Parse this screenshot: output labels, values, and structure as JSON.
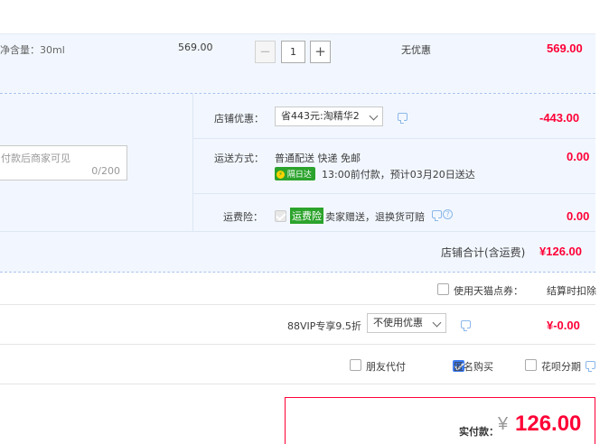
{
  "item": {
    "spec": "净含量：30ml",
    "price": "569.00",
    "qty": "1",
    "minus": "−",
    "plus": "+",
    "discount": "无优惠",
    "subtotal": "569.00"
  },
  "shop": {
    "coupon_label": "店铺优惠：",
    "coupon_select": "省443元:淘精华2",
    "coupon_amount": "-443.00",
    "message_placeholder": "付款后商家可见",
    "message_count": "0/200",
    "shipping_label": "运送方式：",
    "shipping_method": "普通配送 快递 免邮",
    "next_day_badge": "隔日达",
    "delivery_promise": "13:00前付款，预计03月20日送达",
    "shipping_amount": "0.00",
    "insurance_label": "运费险：",
    "insurance_badge": "运费险",
    "insurance_text": "卖家赠送，退换货可赔",
    "insurance_amount": "0.00",
    "total_label": "店铺合计(含运费)",
    "total_amount": "¥126.00"
  },
  "points": {
    "label": "使用天猫点券：",
    "note": "结算时扣除"
  },
  "vip": {
    "label": "88VIP专享9.5折",
    "select": "不使用优惠",
    "amount": "¥-0.00"
  },
  "options": {
    "friend_pay": "朋友代付",
    "anonymous": "匿名购买",
    "huabei": "花呗分期"
  },
  "payment": {
    "label": "实付款：",
    "currency": "¥",
    "amount": "126.00"
  },
  "colors": {
    "accent_red": "#ff0036",
    "light_blue": "#f2f7ff",
    "checkbox_blue": "#3b7cf5",
    "badge_green": "#2ca32c"
  }
}
